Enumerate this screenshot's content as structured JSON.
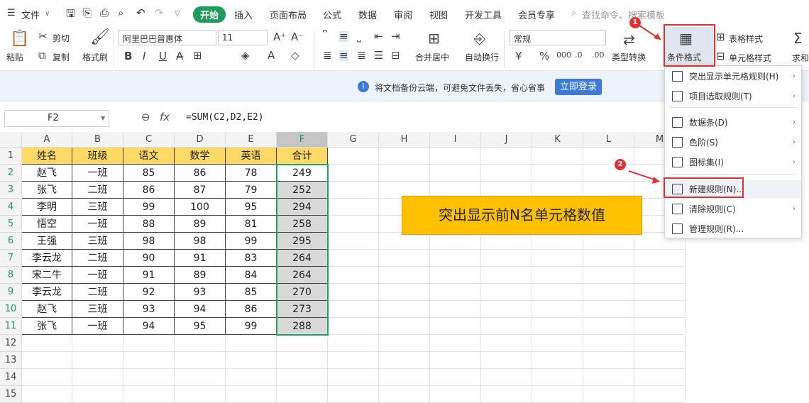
{
  "menubar": {
    "file": "文件",
    "tabs": [
      "开始",
      "插入",
      "页面布局",
      "公式",
      "数据",
      "审阅",
      "视图",
      "开发工具",
      "会员专享"
    ],
    "search_placeholder": "查找命令、搜索模板"
  },
  "ribbon": {
    "paste": "粘贴",
    "cut": "剪切",
    "copy": "复制",
    "format_painter": "格式刷",
    "font_name": "阿里巴巴普惠体",
    "font_size": "11",
    "merge_center": "合并居中",
    "wrap_text": "自动换行",
    "number_format": "常规",
    "type_convert": "类型转换",
    "conditional_format": "条件格式",
    "table_style": "表格样式",
    "cell_style": "单元格样式",
    "sum": "求和"
  },
  "notice": {
    "text": "将文档备份云端，可避免文件丢失，省心省事",
    "login_button": "立即登录"
  },
  "formula_bar": {
    "name_box": "F2",
    "fx": "fx",
    "formula": "=SUM(C2,D2,E2)"
  },
  "sheet": {
    "columns": [
      "A",
      "B",
      "C",
      "D",
      "E",
      "F",
      "G",
      "H",
      "I",
      "J",
      "K",
      "L",
      "M"
    ],
    "row_numbers": [
      "1",
      "2",
      "3",
      "4",
      "5",
      "6",
      "7",
      "8",
      "9",
      "10",
      "11",
      "12",
      "13",
      "14",
      "15"
    ],
    "headers": [
      "姓名",
      "班级",
      "语文",
      "数学",
      "英语",
      "合计"
    ],
    "rows": [
      [
        "赵飞",
        "一班",
        "85",
        "86",
        "78",
        "249"
      ],
      [
        "张飞",
        "二班",
        "86",
        "87",
        "79",
        "252"
      ],
      [
        "李明",
        "三班",
        "99",
        "100",
        "95",
        "294"
      ],
      [
        "悟空",
        "一班",
        "88",
        "89",
        "81",
        "258"
      ],
      [
        "王强",
        "三班",
        "98",
        "98",
        "99",
        "295"
      ],
      [
        "李云龙",
        "二班",
        "90",
        "91",
        "83",
        "264"
      ],
      [
        "宋二牛",
        "一班",
        "91",
        "89",
        "84",
        "264"
      ],
      [
        "李云龙",
        "二班",
        "92",
        "93",
        "85",
        "270"
      ],
      [
        "赵飞",
        "三班",
        "93",
        "94",
        "86",
        "273"
      ],
      [
        "张飞",
        "一班",
        "94",
        "95",
        "99",
        "288"
      ]
    ]
  },
  "banner": {
    "text": "突出显示前N名单元格数值"
  },
  "dropdown": {
    "items": [
      {
        "label": "突出显示单元格规则(H)",
        "arrow": "›"
      },
      {
        "label": "项目选取规则(T)",
        "arrow": "›"
      },
      {
        "label": "数据条(D)",
        "arrow": "›"
      },
      {
        "label": "色阶(S)",
        "arrow": "›"
      },
      {
        "label": "图标集(I)",
        "arrow": "›"
      },
      {
        "label": "新建规则(N)...",
        "arrow": ""
      },
      {
        "label": "清除规则(C)",
        "arrow": "›"
      },
      {
        "label": "管理规则(R)...",
        "arrow": ""
      }
    ]
  },
  "annotations": {
    "badge1": "1",
    "badge2": "2"
  },
  "colors": {
    "accent_green": "#1f9c5b",
    "header_fill": "#ffd966",
    "banner_fill": "#ffc000",
    "highlight_red": "#e03131",
    "selection_green": "#21a366"
  }
}
